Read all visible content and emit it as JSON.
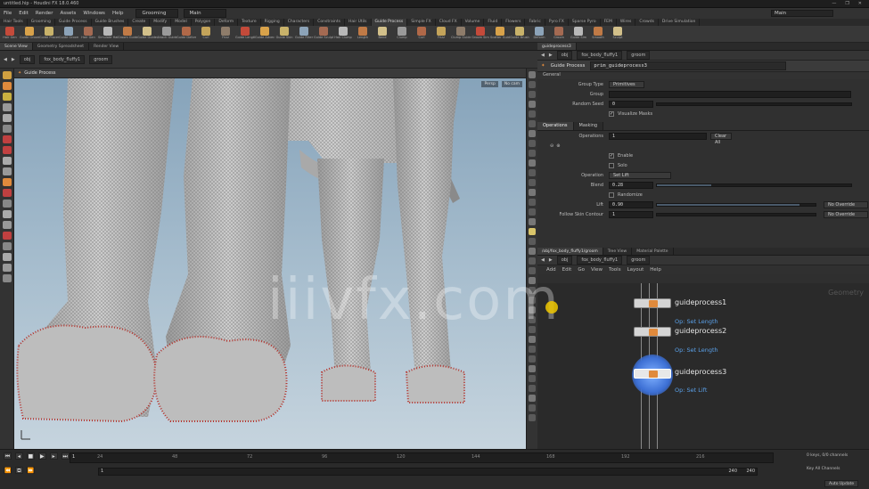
{
  "window": {
    "title": "untitled.hip - Houdini FX 18.0.460",
    "buttons": [
      "—",
      "❐",
      "✕"
    ]
  },
  "menu": {
    "items": [
      "File",
      "Edit",
      "Render",
      "Assets",
      "Windows",
      "Help"
    ],
    "desktop": "Grooming",
    "mode": "Main",
    "search": "Main"
  },
  "shelf_tabs": [
    "Hair Tools",
    "Grooming",
    "Guide Process",
    "Guide Brushes",
    "Create",
    "Modify",
    "Model",
    "Polygon",
    "Deform",
    "Texture",
    "Rigging",
    "Characters",
    "Constraints",
    "Hair Utils",
    "Guide Process",
    "Simple FX",
    "Cloud FX",
    "Volume",
    "Fluid",
    "Flowers",
    "Fabric",
    "Pyro FX",
    "Sparse Pyro",
    "FEM",
    "Wires",
    "Crowds",
    "Drive Simulation"
  ],
  "shelf_tools": [
    "Hair Gen",
    "Guide Groom",
    "Guide Process",
    "Guide Groom",
    "Hair Gen",
    "Simulate Hair",
    "Groom Guides",
    "Guide Guide",
    "Attach Guides",
    "Guide Deform",
    "Curl",
    "Frizz",
    "Guide Length",
    "Guide Advect",
    "Guide Skin",
    "Guide Filter",
    "Guide Sculpt",
    "Hair Clump",
    "Length",
    "Bend",
    "Clump",
    "Curl",
    "Frizz",
    "Clump Guides",
    "Groom Sim",
    "Scatter Guides",
    "Guide Brush",
    "Deform",
    "Groom",
    "Guide Sim",
    "Smooth",
    "Sculpt"
  ],
  "shelf_colors": [
    "#c44a3a",
    "#d8a24a",
    "#c8b26a",
    "#8ca3b8",
    "#a46a52",
    "#b8b8b8",
    "#c07a46",
    "#d2c08a",
    "#9a9a9a",
    "#b06848",
    "#c4a45a",
    "#8e7c6a"
  ],
  "left_pane": {
    "tabs": [
      "Scene View",
      "Geometry Spreadsheet",
      "Render View"
    ],
    "path": [
      "obj",
      "fox_body_fluffy1",
      "groom"
    ],
    "viewport_title": "Guide Process",
    "view_buttons": [
      "Persp",
      "No cam"
    ]
  },
  "params": {
    "tabs": [
      "guideprocess3"
    ],
    "path": [
      "obj",
      "fox_body_fluffy1",
      "groom"
    ],
    "node_type": "Guide Process",
    "node_path": "prim_guideprocess3",
    "general_label": "General",
    "rows": {
      "group_type_label": "Group Type",
      "group_type": "Primitives",
      "group_label": "Group",
      "random_seed_label": "Random Seed",
      "random_seed": "0",
      "visualize_label": "Visualize Masks"
    },
    "op_tabs": [
      "Operations",
      "Masking"
    ],
    "operations_label": "Operations",
    "operations_count": "1",
    "clear_label": "Clear All",
    "enable_label": "Enable",
    "solo_label": "Solo",
    "operation_label": "Operation",
    "operation": "Set Lift",
    "blend_label": "Blend",
    "blend": "0.28",
    "randomize_label": "Randomize",
    "lift_label": "Lift",
    "lift": "0.90",
    "override_label": "No Override",
    "follow_label": "Follow Skin Contour",
    "follow": "1",
    "override2_label": "No Override",
    "sliders": {
      "blend": 0.28,
      "lift": 0.9
    }
  },
  "network": {
    "tabs": [
      "/obj/fox_body_fluffy1/groom",
      "Tree View",
      "Material Palette"
    ],
    "path": [
      "obj",
      "fox_body_fluffy1",
      "groom"
    ],
    "menu": [
      "Add",
      "Edit",
      "Go",
      "View",
      "Tools",
      "Layout",
      "Help"
    ],
    "context_label": "Geometry",
    "nodes": [
      {
        "name": "guideprocess1",
        "op": "Op: Set Length"
      },
      {
        "name": "guideprocess2",
        "op": "Op: Set Length"
      },
      {
        "name": "guideprocess3",
        "op": "Op: Set Lift"
      }
    ]
  },
  "timeline": {
    "start": "1",
    "end": "240",
    "current": "1",
    "end_field": "240",
    "ticks": [
      "24",
      "48",
      "72",
      "96",
      "120",
      "144",
      "168",
      "192",
      "216"
    ],
    "auto_update": "Auto Update",
    "keys1": "0 keys, 0/0 channels",
    "keys2": "Key All Channels"
  },
  "watermark": "iiivfx.com",
  "colors": {
    "accent_orange": "#e08a3c",
    "node_blue": "#5aa0e8",
    "viewport_sky": "#9db4c6",
    "fur_gray": "#c2c2c2",
    "fur_red": "#b4302a"
  }
}
